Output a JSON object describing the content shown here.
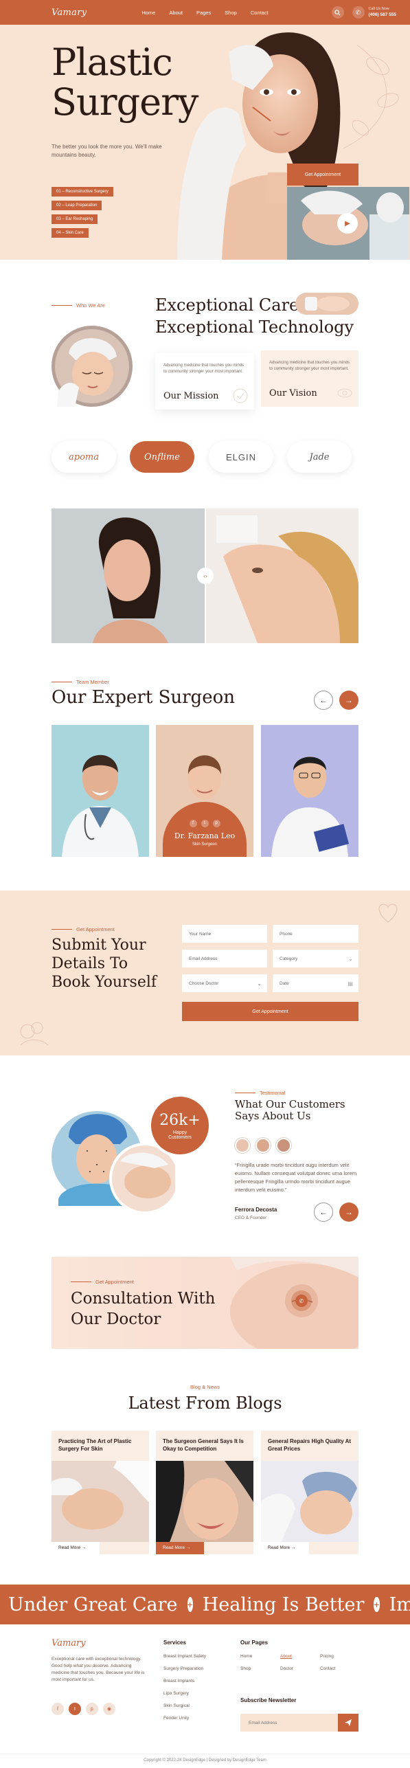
{
  "header": {
    "logo": "Vamary",
    "nav": [
      "Home",
      "About",
      "Pages",
      "Shop",
      "Contact"
    ],
    "call_label": "Call Us Now",
    "call_number": "(406) 587 555"
  },
  "hero": {
    "title_line1": "Plastic",
    "title_line2": "Surgery",
    "description": "The better you look the more you. We'll make mountains beauty.",
    "tags": [
      "01 – Reconstructive Surgery",
      "02 – Leap Preparation",
      "03 – Ear Reshaping",
      "04 – Skin Care"
    ],
    "cta": "Get Appointment"
  },
  "about": {
    "label": "Who We Are",
    "title_line1": "Exceptional Care",
    "title_line2": "Exceptional Technology",
    "mission_text": "Advancing medicine that touches you minds to community stronger your most important.",
    "mission_title": "Our Mission",
    "vision_text": "Advancing medicine that touches you minds to community stronger your most important.",
    "vision_title": "Our Vision"
  },
  "brands": [
    "apoma",
    "Onflime",
    "ELGIN",
    "Jade"
  ],
  "team": {
    "label": "Team Member",
    "title": "Our Expert Surgeon",
    "featured_name": "Dr. Farzana Leo",
    "featured_role": "Skin Surgeon"
  },
  "appointment": {
    "label": "Get Appointment",
    "title_line1": "Submit Your",
    "title_line2": "Details To",
    "title_line3": "Book Yourself",
    "fields": {
      "name": "Your Name",
      "phone": "Phone",
      "email": "Email Address",
      "category": "Category",
      "doctor": "Choose Doctor",
      "date": "Date"
    },
    "submit": "Get Appointment"
  },
  "testimonial": {
    "stat_value": "26k+",
    "stat_label_1": "Happy",
    "stat_label_2": "Customers",
    "label": "Testimonial",
    "title_line1": "What Our Customers",
    "title_line2": "Says About Us",
    "quote": "“Fringilla urade morbi tincidunt augu interdum velit euismo. Nullam consequat volutpat donec urna lorem pellentesque Fringilla urmdo morbi tincidunt augue interdum velit euismo.”",
    "author": "Ferrora Decosta",
    "author_role": "CEO & Founder"
  },
  "consult": {
    "label": "Get Appointment",
    "title_line1": "Consultation With",
    "title_line2": "Our Doctor"
  },
  "blogs": {
    "label": "Blog & News",
    "title": "Latest From Blogs",
    "posts": [
      {
        "title": "Practicing The Art of Plastic Surgery For Skin",
        "more": "Read More"
      },
      {
        "title": "The Surgeon General Says It Is Okay to Competition",
        "more": "Read More"
      },
      {
        "title": "General Repairs High Quality At Great Prices",
        "more": "Read More"
      }
    ]
  },
  "marquee": [
    "Under Great Care",
    "Healing Is Better",
    "Improving"
  ],
  "footer": {
    "logo": "Vamary",
    "about": "Exceptional care with exceptional technology. Good help what you deserve. Advancing medicine that touches you. Because your life is most important for us.",
    "services_title": "Services",
    "services": [
      "Breast Implant Safety",
      "Surgery Preparation",
      "Breast Implants",
      "Lipo Surgery",
      "Skin Surgical",
      "Fender Unity"
    ],
    "pages_title": "Our Pages",
    "pages": [
      "Home",
      "About",
      "Pricing",
      "Shop",
      "Doctor",
      "Contact"
    ],
    "newsletter_title": "Subscribe Newsletter",
    "newsletter_placeholder": "Email Address",
    "copyright": "Copyright © 2022-24 DesignEdge | Designed by DesignEdge Team"
  },
  "colors": {
    "accent": "#c8623a",
    "cream": "#f9e3d3",
    "dark": "#2c1a15"
  }
}
